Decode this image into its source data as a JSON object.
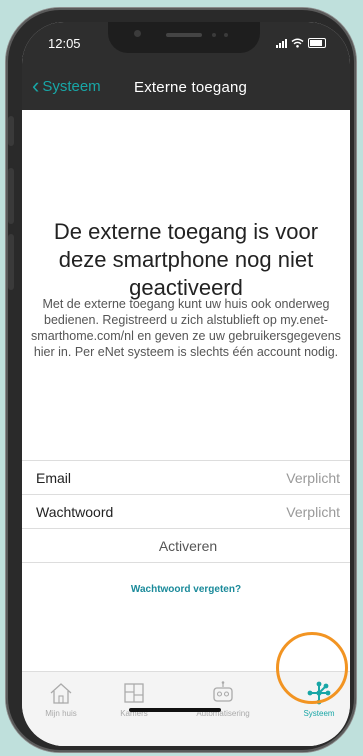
{
  "status_bar": {
    "time": "12:05"
  },
  "nav": {
    "back_label": "Systeem",
    "title": "Externe toegang"
  },
  "main": {
    "headline": "De externe toegang is voor deze smartphone nog niet geactiveerd",
    "description": "Met de externe toegang kunt uw huis ook onderweg bedienen. Registreerd u zich alstublieft op my.enet-smarthome.com/nl en geven ze uw gebruikersgegevens hier in. Per eNet systeem is slechts één account nodig."
  },
  "form": {
    "email_label": "Email",
    "email_placeholder": "Verplicht",
    "password_label": "Wachtwoord",
    "password_placeholder": "Verplicht",
    "activate_label": "Activeren",
    "forgot_label": "Wachtwoord vergeten?"
  },
  "tabbar": {
    "items": [
      {
        "label": "Mijn huis",
        "icon": "house-icon",
        "active": false
      },
      {
        "label": "Kamers",
        "icon": "rooms-icon",
        "active": false
      },
      {
        "label": "Automatisering",
        "icon": "robot-icon",
        "active": false
      },
      {
        "label": "Systeem",
        "icon": "network-icon",
        "active": true
      }
    ]
  },
  "colors": {
    "accent": "#18a6a6",
    "highlight_ring": "#f29422",
    "nav_bg": "#2e2e2e",
    "background": "#bfe0dc"
  }
}
